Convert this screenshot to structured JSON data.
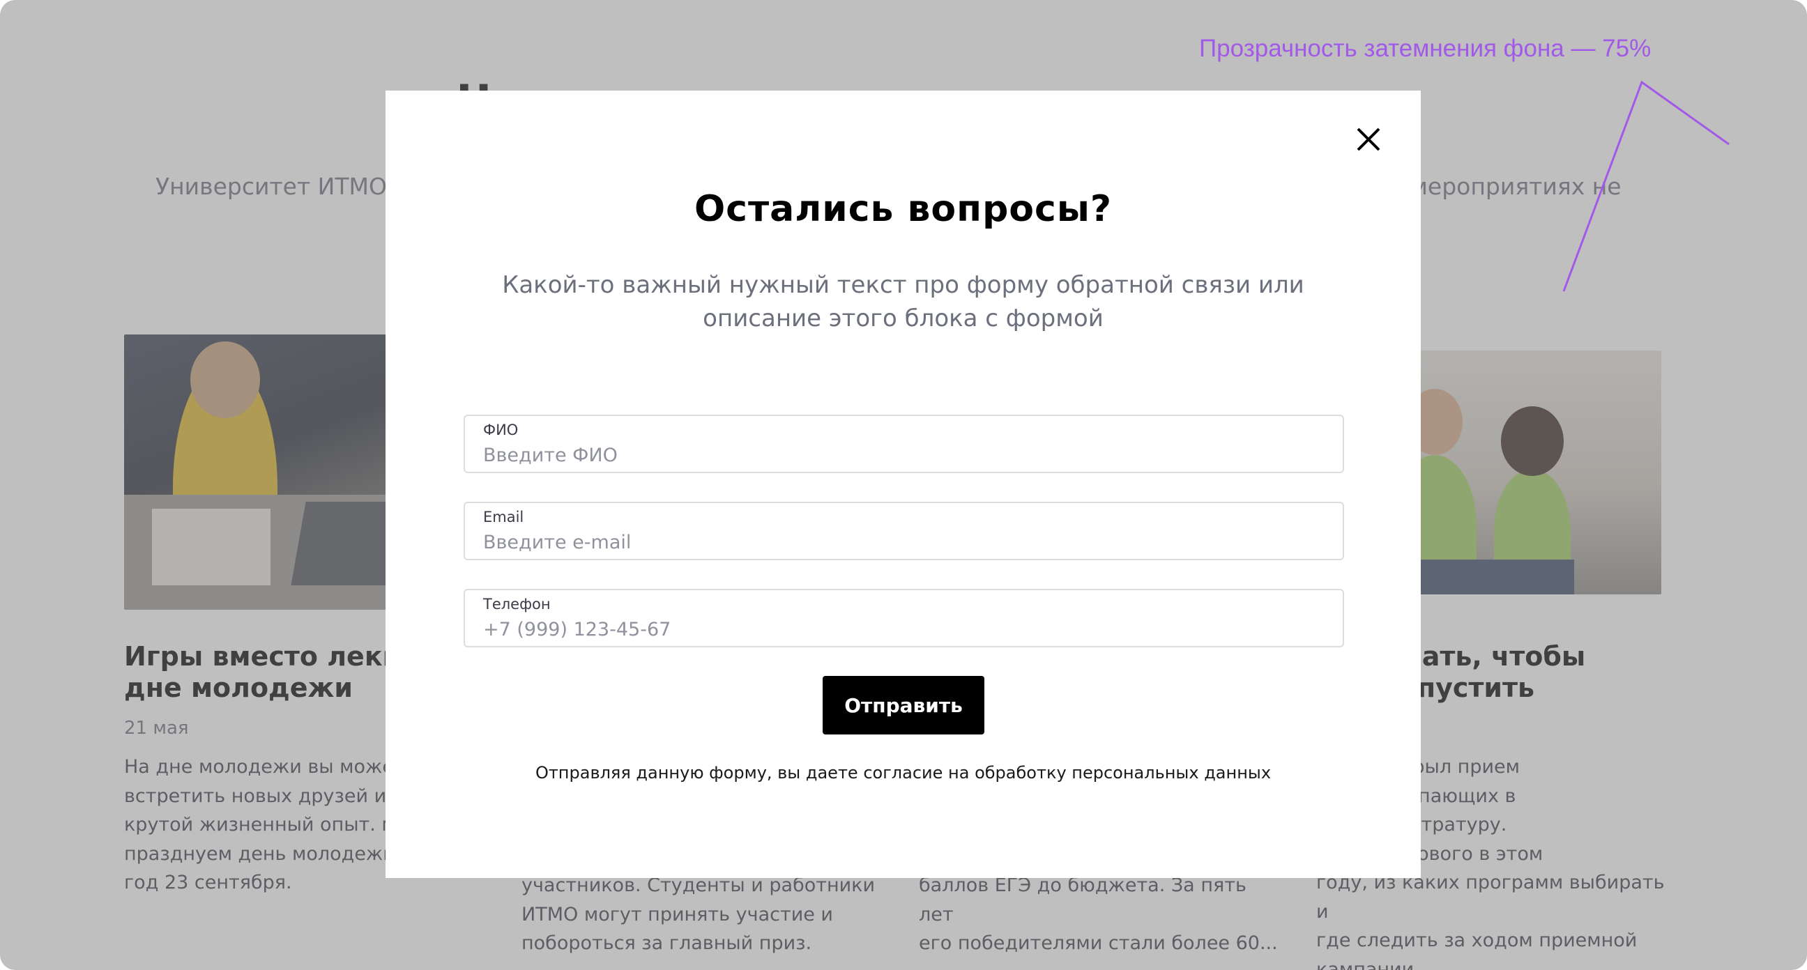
{
  "background": {
    "heading": "Ч",
    "intro_left": "Университет ИТМО",
    "intro_right": "х мероприятиях не",
    "cards": [
      {
        "title": "Игры вместо лекц\nдне молодежи",
        "date": "21 мая",
        "text": "На дне молодежи вы может\nвстретить новых друзей и о\nкрутой жизненный опыт. мы\nпразднуем день молодежи\nгод 23 сентября."
      },
      {
        "title": "",
        "date": "",
        "text": "участников. Студенты и работники\nИТМО могут принять участие и\nпобороться за главный приз."
      },
      {
        "title": "",
        "date": "",
        "text": "баллов ЕГЭ до бюджета. За пять лет\nего победителями стали более 60..."
      },
      {
        "title": "жно знать, чтобы\n не пропустить",
        "date": "",
        "text": "ИТМО открыл прием\nв от поступающих в\nат и магистратуру.\nаем, что нового в этом\nгоду, из каких программ выбирать и\nгде следить за ходом приемной\nкампании"
      }
    ]
  },
  "annotation": {
    "text": "Прозрачность затемнения фона — 75%",
    "color": "#a259e8"
  },
  "modal": {
    "close_icon": "close-icon",
    "title": "Остались вопросы?",
    "lead": "Какой-то важный нужный текст про форму обратной связи или описание этого блока с формой",
    "fields": {
      "name": {
        "label": "ФИО",
        "placeholder": "Введите ФИО",
        "value": ""
      },
      "email": {
        "label": "Email",
        "placeholder": "Введите e-mail",
        "value": ""
      },
      "phone": {
        "label": "Телефон",
        "placeholder": "+7 (999) 123-45-67",
        "value": ""
      }
    },
    "submit_label": "Отправить",
    "consent": "Отправляя данную форму, вы даете согласие на обработку персональных данных"
  },
  "colors": {
    "overlay": "#808080",
    "button_bg": "#000000",
    "muted_text": "#6c6f7c"
  }
}
